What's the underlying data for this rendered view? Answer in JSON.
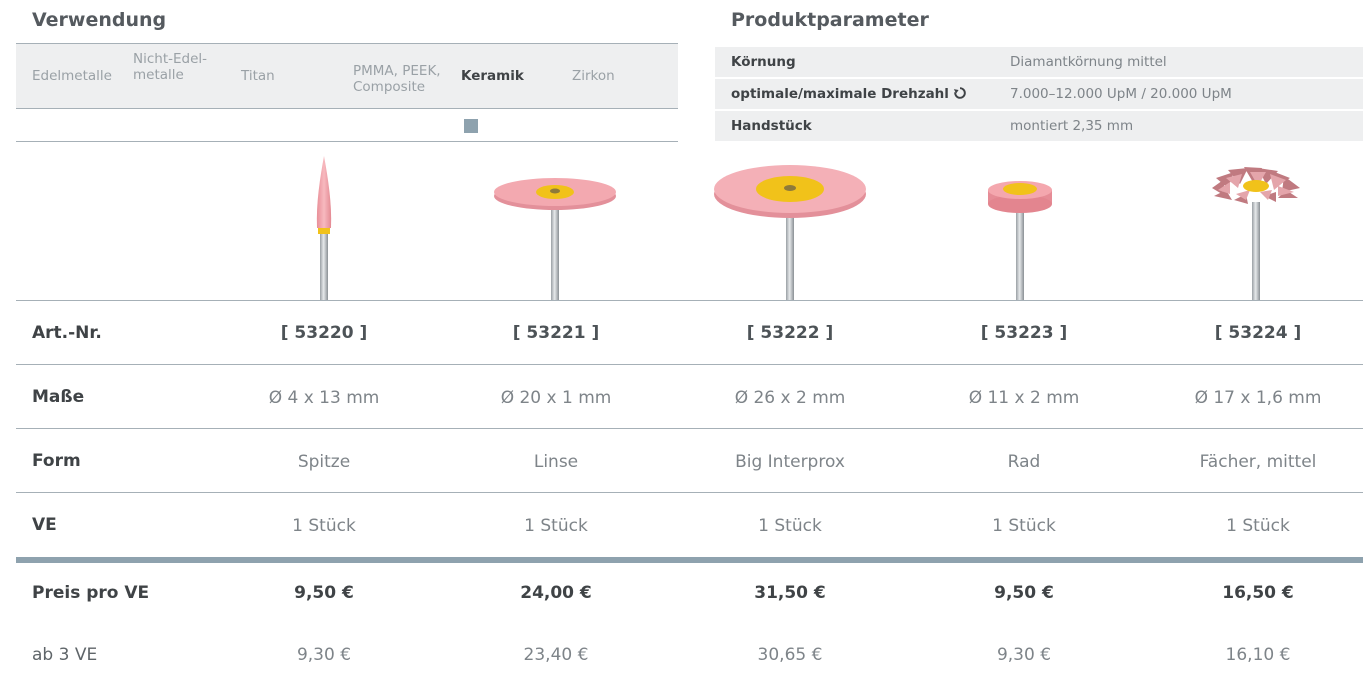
{
  "verwendung": {
    "title": "Verwendung",
    "columns": [
      {
        "label": "Edelmetalle",
        "bold": false
      },
      {
        "label": "Nicht-Edel-\nmetalle",
        "bold": false
      },
      {
        "label": "Titan",
        "bold": false
      },
      {
        "label": "PMMA, PEEK,\nComposite",
        "bold": false
      },
      {
        "label": "Keramik",
        "bold": true
      },
      {
        "label": "Zirkon",
        "bold": false
      }
    ],
    "marked_column": "Keramik"
  },
  "produktparameter": {
    "title": "Produktparameter",
    "rows": [
      {
        "key": "Körnung",
        "value": "Diamantkörnung mittel"
      },
      {
        "key": "optimale/maximale Drehzahl",
        "value": "7.000–12.000 UpM / 20.000 UpM",
        "icon": "rotation-icon"
      },
      {
        "key": "Handstück",
        "value": "montiert 2,35 mm"
      }
    ]
  },
  "colors": {
    "rule": "#a6b0b7",
    "accent_bar": "#8ea2ae",
    "header_bg": "#eeeff0",
    "polisher_pink": "#f2a3aa",
    "polisher_yellow": "#f1c21a"
  },
  "products": {
    "row_labels": {
      "art": "Art.-Nr.",
      "masse": "Maße",
      "form": "Form",
      "ve": "VE",
      "preis": "Preis pro VE",
      "ab3": "ab 3 VE"
    },
    "items": [
      {
        "shape": "flame-icon",
        "art": "[ 53220 ]",
        "masse": "Ø 4 x 13 mm",
        "form": "Spitze",
        "ve": "1 Stück",
        "preis": "9,50 €",
        "ab3": "9,30 €"
      },
      {
        "shape": "lens-icon",
        "art": "[ 53221 ]",
        "masse": "Ø 20 x 1 mm",
        "form": "Linse",
        "ve": "1 Stück",
        "preis": "24,00 €",
        "ab3": "23,40 €"
      },
      {
        "shape": "big-disc-icon",
        "art": "[ 53222 ]",
        "masse": "Ø 26 x 2 mm",
        "form": "Big Interprox",
        "ve": "1 Stück",
        "preis": "31,50 €",
        "ab3": "30,65 €"
      },
      {
        "shape": "wheel-icon",
        "art": "[ 53223 ]",
        "masse": "Ø 11 x 2 mm",
        "form": "Rad",
        "ve": "1 Stück",
        "preis": "9,50 €",
        "ab3": "9,30 €"
      },
      {
        "shape": "fan-brush-icon",
        "art": "[ 53224 ]",
        "masse": "Ø 17 x 1,6 mm",
        "form": "Fächer, mittel",
        "ve": "1 Stück",
        "preis": "16,50 €",
        "ab3": "16,10 €"
      }
    ]
  }
}
